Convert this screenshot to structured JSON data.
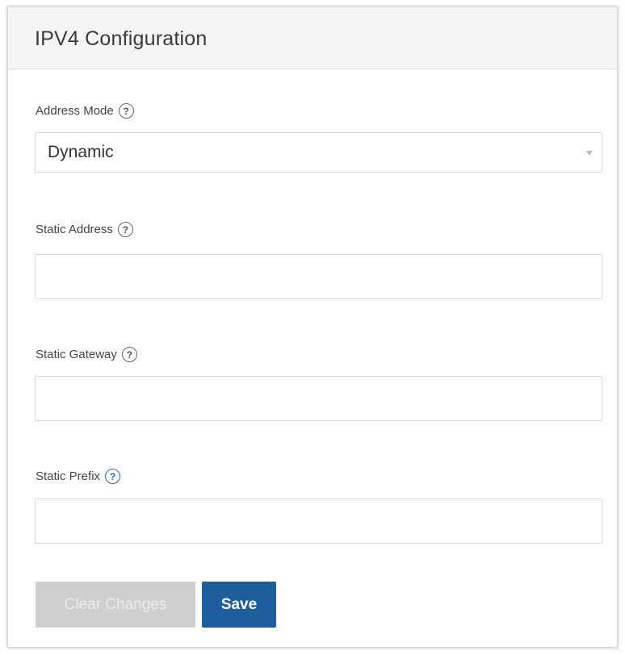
{
  "panel": {
    "title": "IPV4 Configuration"
  },
  "fields": {
    "address_mode": {
      "label": "Address Mode",
      "help_icon": "question-circle-icon",
      "selected": "Dynamic",
      "arrow_icon": "caret-down-icon"
    },
    "static_address": {
      "label": "Static Address",
      "help_icon": "question-circle-icon",
      "value": ""
    },
    "static_gateway": {
      "label": "Static Gateway",
      "help_icon": "question-circle-icon",
      "value": ""
    },
    "static_prefix": {
      "label": "Static Prefix",
      "help_icon": "question-circle-icon",
      "value": ""
    }
  },
  "help_glyph": "?",
  "buttons": {
    "clear_label": "Clear Changes",
    "save_label": "Save"
  },
  "colors": {
    "save_button": "#1f5e9c",
    "clear_button_disabled": "#cfcfcf",
    "prefix_help_icon": "#2a6aa8"
  }
}
